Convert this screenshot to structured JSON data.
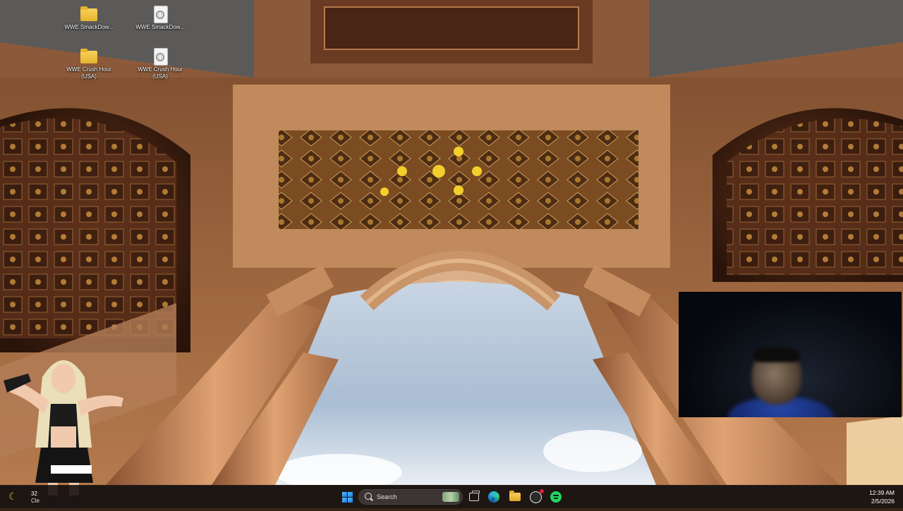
{
  "desktop": {
    "icons": [
      {
        "label": "WWE SmackDow...",
        "type": "folder-icon"
      },
      {
        "label": "WWE SmackDow...",
        "type": "disc-image-icon"
      },
      {
        "label": "WWE Crush Hour (USA)",
        "type": "folder-icon"
      },
      {
        "label": "WWE Crush Hour (USA)",
        "type": "disc-image-icon"
      }
    ]
  },
  "taskbar": {
    "weather": {
      "temp": "32",
      "condition": "Cle",
      "icon": "moon-icon"
    },
    "search_label": "Search",
    "apps": [
      {
        "name": "start-button",
        "icon": "windows-icon"
      },
      {
        "name": "task-view-button",
        "icon": "task-view-icon"
      },
      {
        "name": "edge-button",
        "icon": "edge-icon"
      },
      {
        "name": "file-explorer-button",
        "icon": "folder-icon"
      },
      {
        "name": "obs-button",
        "icon": "obs-record-icon"
      },
      {
        "name": "spotify-button",
        "icon": "spotify-icon"
      }
    ],
    "clock": {
      "time": "12:39 AM",
      "date": "2/5/2026"
    }
  },
  "colors": {
    "taskbar": "#1c1614",
    "accent": "#1a73e8"
  }
}
